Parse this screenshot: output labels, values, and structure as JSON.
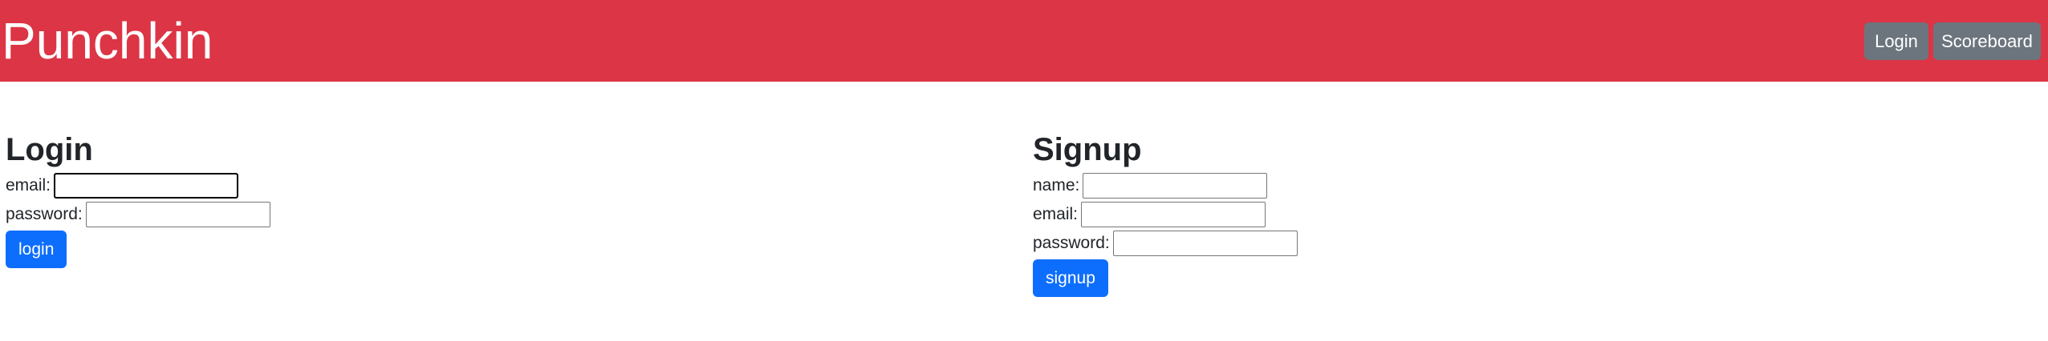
{
  "navbar": {
    "brand": "Punchkin",
    "login_label": "Login",
    "scoreboard_label": "Scoreboard",
    "background_color": "#dc3545"
  },
  "login": {
    "title": "Login",
    "email_label": "email:",
    "email_value": "",
    "password_label": "password:",
    "password_value": "",
    "submit_label": "login"
  },
  "signup": {
    "title": "Signup",
    "name_label": "name:",
    "name_value": "",
    "email_label": "email:",
    "email_value": "",
    "password_label": "password:",
    "password_value": "",
    "submit_label": "signup"
  },
  "colors": {
    "primary": "#0d6efd",
    "secondary": "#6c757d"
  }
}
